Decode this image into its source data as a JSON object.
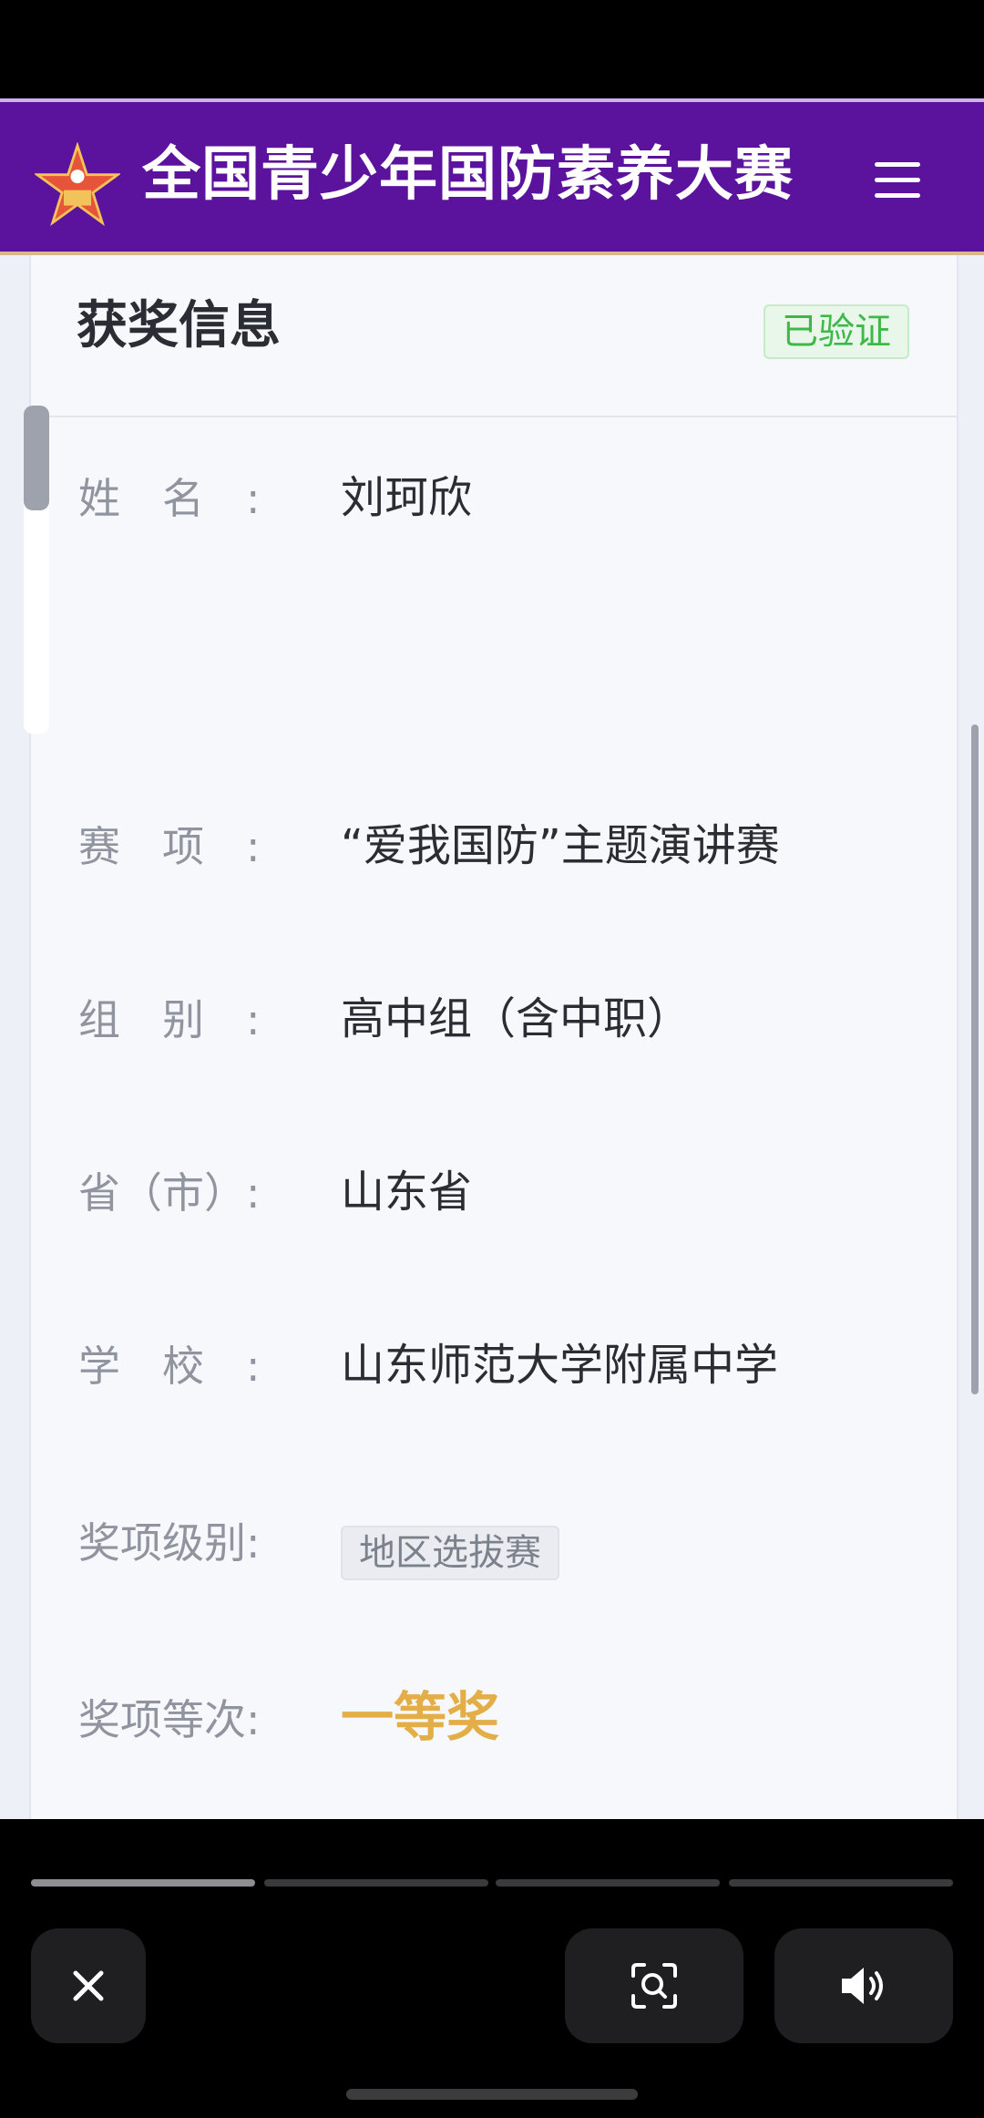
{
  "header": {
    "title": "全国青少年国防素养大赛"
  },
  "card": {
    "title": "获奖信息",
    "badge": "已验证",
    "fields": [
      {
        "label": "姓　名　:",
        "value": "刘珂欣"
      },
      {
        "label": "赛　项　:",
        "value": "“爱我国防”主题演讲赛"
      },
      {
        "label": "组　别　:",
        "value": "高中组（含中职）"
      },
      {
        "label": "省（市）:",
        "value": "山东省"
      },
      {
        "label": "学　校　:",
        "value": "山东师范大学附属中学"
      },
      {
        "label": "奖项级别:",
        "value": "地区选拔赛"
      },
      {
        "label": "奖项等次:",
        "value": "一等奖"
      }
    ]
  },
  "story": {
    "segments_total": 4,
    "active_segment": 1
  },
  "colors": {
    "header_bg": "#5b129c",
    "verified_green": "#3fb84a",
    "grade_gold": "#e3ae48"
  }
}
